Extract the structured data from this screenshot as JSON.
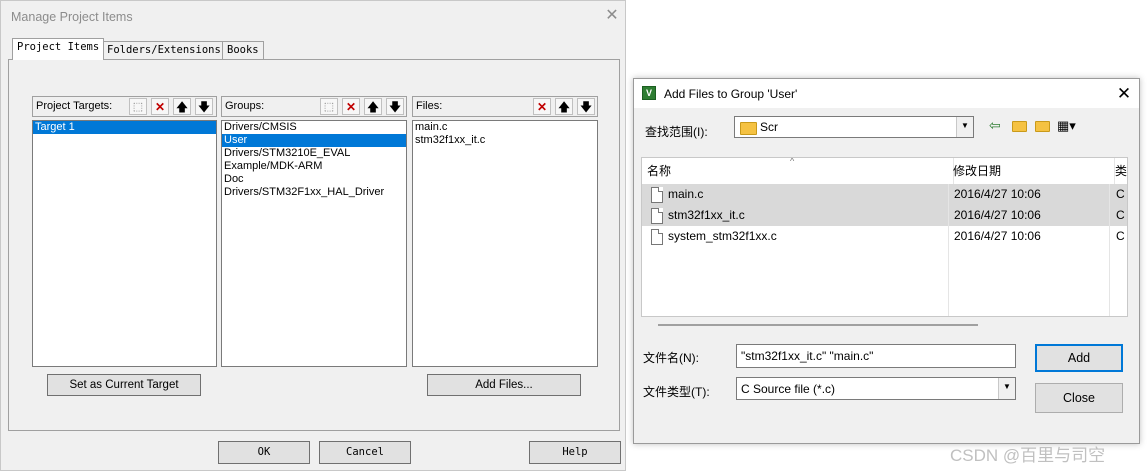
{
  "manage_dialog": {
    "title": "Manage Project Items",
    "close_glyph": "✕",
    "tabs": [
      "Project Items",
      "Folders/Extensions",
      "Books"
    ],
    "targets": {
      "label": "Project Targets:",
      "items": [
        "Target 1"
      ],
      "selected": 0
    },
    "groups": {
      "label": "Groups:",
      "items": [
        "Drivers/CMSIS",
        "User",
        "Drivers/STM3210E_EVAL",
        "Example/MDK-ARM",
        "Doc",
        "Drivers/STM32F1xx_HAL_Driver"
      ],
      "selected": 1
    },
    "files": {
      "label": "Files:",
      "items": [
        "main.c",
        "stm32f1xx_it.c"
      ]
    },
    "set_current_target_label": "Set as Current Target",
    "add_files_label": "Add Files...",
    "ok_label": "OK",
    "cancel_label": "Cancel",
    "help_label": "Help"
  },
  "add_files_dialog": {
    "title": "Add Files to Group 'User'",
    "close_glyph": "✕",
    "look_in_label": "查找范围(I):",
    "look_in_value": "Scr",
    "columns": {
      "name": "名称",
      "date": "修改日期",
      "type": "类"
    },
    "files": [
      {
        "name": "main.c",
        "date": "2016/4/27 10:06",
        "type": "C",
        "selected": true
      },
      {
        "name": "stm32f1xx_it.c",
        "date": "2016/4/27 10:06",
        "type": "C",
        "selected": true
      },
      {
        "name": "system_stm32f1xx.c",
        "date": "2016/4/27 10:06",
        "type": "C",
        "selected": false
      }
    ],
    "filename_label": "文件名(N):",
    "filename_value": "\"stm32f1xx_it.c\" \"main.c\"",
    "filetype_label": "文件类型(T):",
    "filetype_value": "C Source file (*.c)",
    "add_label": "Add",
    "close_label": "Close"
  },
  "watermark": "CSDN @百里与司空",
  "colors": {
    "selection": "#0078d7",
    "default_button_border": "#0078d7",
    "list_selected_row": "#d9d9d9"
  }
}
